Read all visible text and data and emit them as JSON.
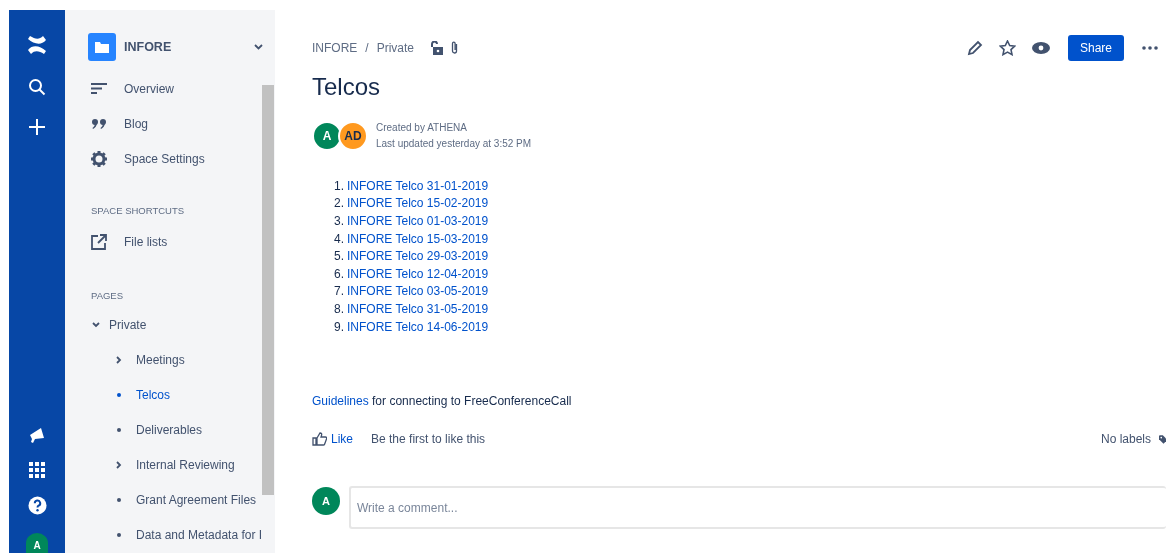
{
  "global_nav": {
    "avatar": "A"
  },
  "sidebar": {
    "space_name": "INFORE",
    "items": [
      {
        "label": "Overview"
      },
      {
        "label": "Blog"
      },
      {
        "label": "Space Settings"
      }
    ],
    "shortcuts_heading": "SPACE SHORTCUTS",
    "shortcuts": [
      {
        "label": "File lists"
      }
    ],
    "pages_heading": "PAGES",
    "pages": [
      {
        "label": "Private",
        "expanded": true,
        "selected": false,
        "children": [
          {
            "label": "Meetings",
            "expandable": true,
            "selected": false
          },
          {
            "label": "Telcos",
            "expandable": false,
            "selected": true
          },
          {
            "label": "Deliverables",
            "expandable": false,
            "selected": false
          },
          {
            "label": "Internal Reviewing",
            "expandable": true,
            "selected": false
          },
          {
            "label": "Grant Agreement Files",
            "expandable": false,
            "selected": false
          },
          {
            "label": "Data and Metadata for I",
            "expandable": false,
            "selected": false
          }
        ]
      }
    ]
  },
  "breadcrumbs": [
    "INFORE",
    "/",
    "Private"
  ],
  "share_button": "Share",
  "title": "Telcos",
  "byline": {
    "avatars": [
      {
        "initials": "A",
        "color": "#00875a"
      },
      {
        "initials": "AD",
        "color": "#ff991f"
      }
    ],
    "created": "Created by ATHENA",
    "updated": "Last updated yesterday at 3:52 PM"
  },
  "list": [
    {
      "number": "1.",
      "link": "INFORE Telco 31-01-2019"
    },
    {
      "number": "2.",
      "link": "INFORE Telco 15-02-2019"
    },
    {
      "number": "3.",
      "link": "INFORE Telco 01-03-2019"
    },
    {
      "number": "4.",
      "link": "INFORE Telco 15-03-2019"
    },
    {
      "number": "5.",
      "link": "INFORE Telco 29-03-2019"
    },
    {
      "number": "6.",
      "link": "INFORE Telco 12-04-2019"
    },
    {
      "number": "7.",
      "link": "INFORE Telco 03-05-2019"
    },
    {
      "number": "8.",
      "link": "INFORE Telco 31-05-2019"
    },
    {
      "number": "9.",
      "link": "INFORE Telco 14-06-2019"
    }
  ],
  "guidelines": {
    "link": "Guidelines",
    "text": " for connecting to FreeConferenceCall"
  },
  "like": {
    "button": "Like",
    "text": "Be the first to like this"
  },
  "labels": "No labels",
  "comment": {
    "avatar": "A",
    "placeholder": "Write a comment..."
  }
}
